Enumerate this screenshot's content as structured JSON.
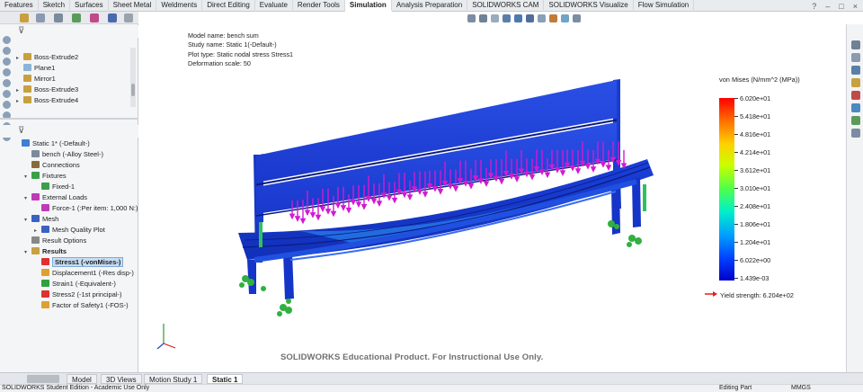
{
  "tabs": [
    "Features",
    "Sketch",
    "Surfaces",
    "Sheet Metal",
    "Weldments",
    "Direct Editing",
    "Evaluate",
    "Render Tools",
    "Simulation",
    "Analysis Preparation",
    "SOLIDWORKS CAM",
    "SOLIDWORKS Visualize",
    "Flow Simulation"
  ],
  "active_tab": "Simulation",
  "window_controls": [
    "?",
    "–",
    "□",
    "×"
  ],
  "feature_tree": [
    {
      "label": "Boss-Extrude2",
      "arrow": "▸",
      "icon_color": "#c8a040"
    },
    {
      "label": "Plane1",
      "arrow": "",
      "icon_color": "#8cb4d8"
    },
    {
      "label": "Mirror1",
      "arrow": "",
      "icon_color": "#c8a040"
    },
    {
      "label": "Boss-Extrude3",
      "arrow": "▸",
      "icon_color": "#c8a040"
    },
    {
      "label": "Boss-Extrude4",
      "arrow": "▸",
      "icon_color": "#c8a040"
    }
  ],
  "sim_tree": [
    {
      "label": "Static 1* (-Default-)",
      "arrow": "",
      "indent": 0,
      "icon_color": "#3d7fd1"
    },
    {
      "label": "bench (-Alloy Steel-)",
      "arrow": "",
      "indent": 1,
      "icon_color": "#7a8b9c"
    },
    {
      "label": "Connections",
      "arrow": "",
      "indent": 1,
      "icon_color": "#8a6a3a"
    },
    {
      "label": "Fixtures",
      "arrow": "▾",
      "indent": 1,
      "icon_color": "#3aa04a"
    },
    {
      "label": "Fixed-1",
      "arrow": "",
      "indent": 2,
      "icon_color": "#3aa04a"
    },
    {
      "label": "External Loads",
      "arrow": "▾",
      "indent": 1,
      "icon_color": "#c03ab8"
    },
    {
      "label": "Force-1 (:Per item: 1,000 N:)",
      "arrow": "",
      "indent": 2,
      "icon_color": "#c03ab8"
    },
    {
      "label": "Mesh",
      "arrow": "▾",
      "indent": 1,
      "icon_color": "#3a60c0"
    },
    {
      "label": "Mesh Quality Plot",
      "arrow": "▸",
      "indent": 2,
      "icon_color": "#3a60c0"
    },
    {
      "label": "Result Options",
      "arrow": "",
      "indent": 1,
      "icon_color": "#888888"
    },
    {
      "label": "Results",
      "arrow": "▾",
      "indent": 1,
      "icon_color": "#c8a040",
      "bold": true
    },
    {
      "label": "Stress1 (-vonMises-)",
      "arrow": "",
      "indent": 2,
      "icon_color": "#e03030",
      "selected": true
    },
    {
      "label": "Displacement1 (-Res disp-)",
      "arrow": "",
      "indent": 2,
      "icon_color": "#e0a030"
    },
    {
      "label": "Strain1 (-Equivalent-)",
      "arrow": "",
      "indent": 2,
      "icon_color": "#30a040"
    },
    {
      "label": "Stress2 (-1st principal-)",
      "arrow": "",
      "indent": 2,
      "icon_color": "#e03030"
    },
    {
      "label": "Factor of Safety1 (-FOS-)",
      "arrow": "",
      "indent": 2,
      "icon_color": "#e0a030"
    }
  ],
  "plot_info": {
    "model_name": "Model name: bench sum",
    "study_name": "Study name: Static 1(-Default-)",
    "plot_type": "Plot type: Static nodal stress Stress1",
    "deformation_scale": "Deformation scale: 50"
  },
  "legend": {
    "title": "von Mises (N/mm^2 (MPa))",
    "values": [
      "6.020e+01",
      "5.418e+01",
      "4.816e+01",
      "4.214e+01",
      "3.612e+01",
      "3.010e+01",
      "2.408e+01",
      "1.806e+01",
      "1.204e+01",
      "6.022e+00",
      "1.439e-03"
    ],
    "yield_strength": "Yield strength: 6.204e+02",
    "colors": {
      "top": "#ff0000",
      "bottom": "#0000c8",
      "yield_arrow": "#e02020"
    }
  },
  "watermark": "SOLIDWORKS Educational Product. For Instructional Use Only.",
  "bottom_tabs": [
    "Model",
    "3D Views",
    "Motion Study 1",
    "Static 1"
  ],
  "active_bottom_tab": "Static 1",
  "status": {
    "left": "SOLIDWORKS Student Edition - Academic Use Only",
    "mode": "Editing Part",
    "units": "MMGS"
  },
  "colors": {
    "bench_blue": "#1a3fd8",
    "load_arrow": "#d21ad2",
    "fixture": "#30b040"
  }
}
